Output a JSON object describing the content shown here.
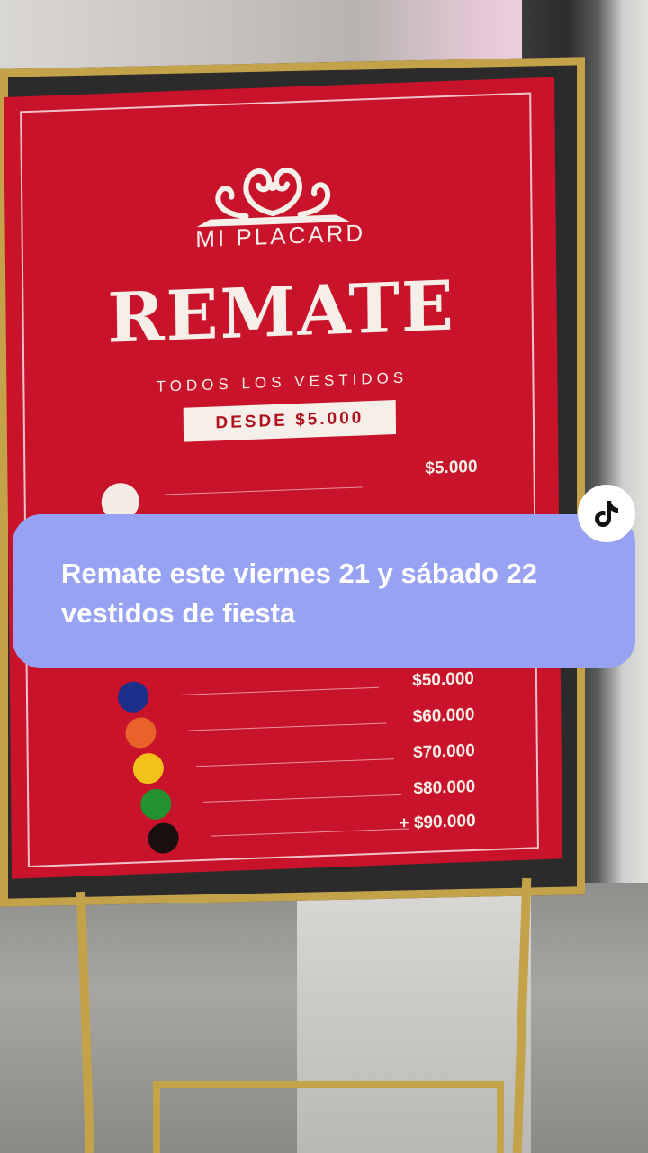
{
  "sign": {
    "brand": "MI PLACARD",
    "headline": "REMATE",
    "subtitle": "TODOS LOS VESTIDOS",
    "badge": "DESDE $5.000",
    "price_list": [
      {
        "color": "#f3ece6",
        "price": "$5.000"
      },
      {
        "color": "#3a8fc7",
        "price": ""
      },
      {
        "color": "#1c2f8a",
        "price": "$50.000"
      },
      {
        "color": "#e8622a",
        "price": "$60.000"
      },
      {
        "color": "#f0c21a",
        "price": "$70.000"
      },
      {
        "color": "#23912f",
        "price": "$80.000"
      },
      {
        "color": "#1a1010",
        "price": "+ $90.000"
      }
    ]
  },
  "overlay": {
    "caption": "Remate este viernes 21 y sábado 22 vestidos de fiesta",
    "logo_icon": "tiktok-icon"
  },
  "colors": {
    "board_red": "#c8132a",
    "frame_gold": "#c3a24a",
    "caption_bg": "#97a3f2"
  }
}
